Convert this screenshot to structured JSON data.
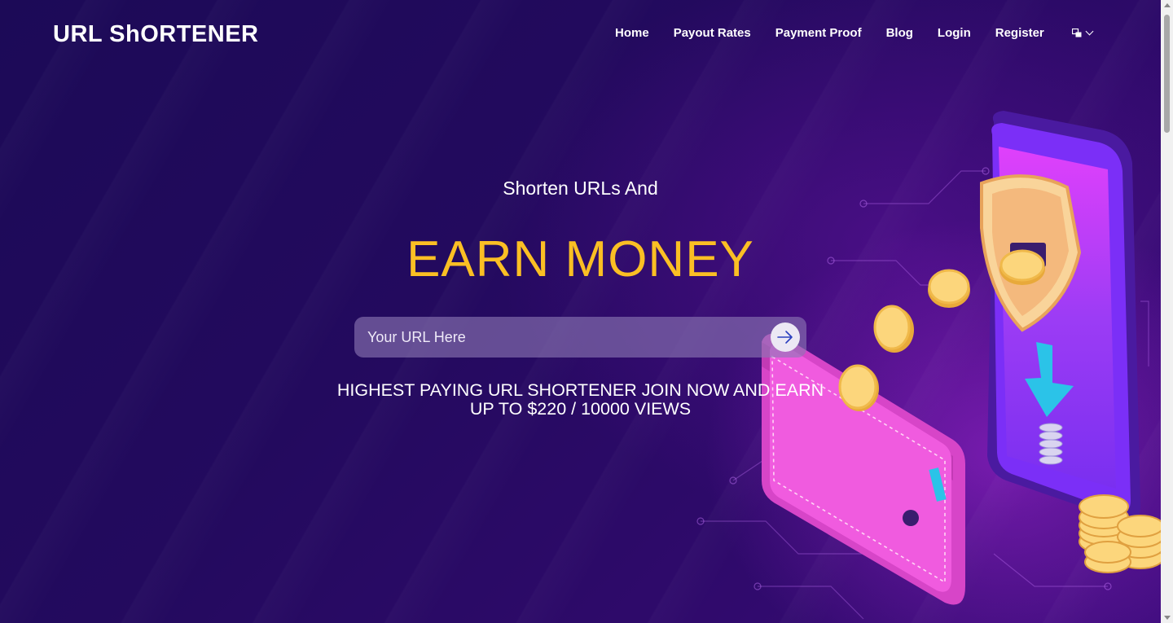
{
  "header": {
    "logo": "URL ShORTENER",
    "nav": [
      "Home",
      "Payout Rates",
      "Payment Proof",
      "Blog",
      "Login",
      "Register"
    ]
  },
  "hero": {
    "subtitle": "Shorten URLs And",
    "headline": "EARN MONEY",
    "input_placeholder": "Your URL Here",
    "tagline_line1": "HIGHEST PAYING URL SHORTENER JOIN NOW AND EARN",
    "tagline_line2": "UP TO $220 / 10000 VIEWS"
  },
  "icons": {
    "language": "translate-icon",
    "chevron": "chevron-down-icon",
    "submit": "arrow-right-icon"
  },
  "colors": {
    "background": "#1c0a57",
    "accent": "#fbbf24",
    "input_bg": "#8c78b4"
  }
}
